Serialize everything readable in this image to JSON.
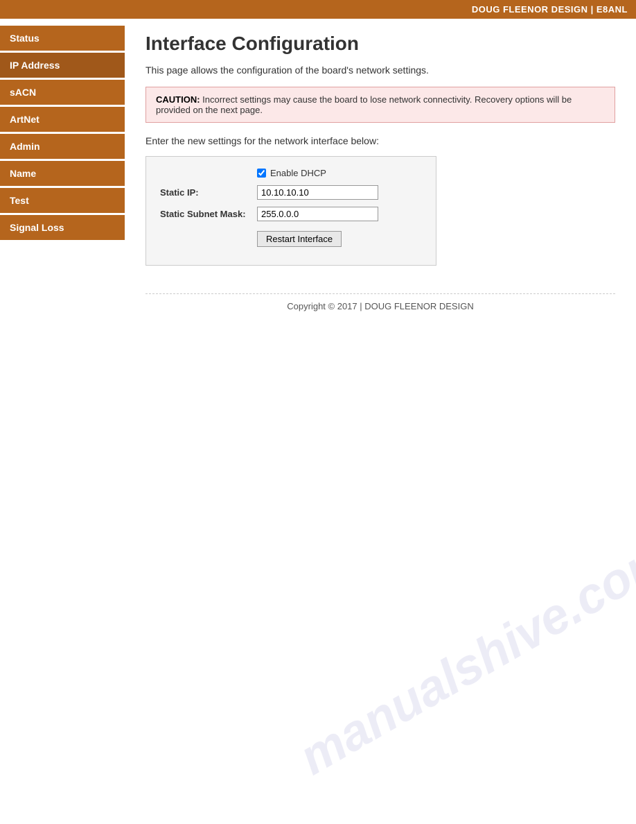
{
  "header": {
    "brand": "DOUG FLEENOR DESIGN | E8ANL"
  },
  "sidebar": {
    "items": [
      {
        "id": "status",
        "label": "Status"
      },
      {
        "id": "ip-address",
        "label": "IP Address"
      },
      {
        "id": "sacn",
        "label": "sACN"
      },
      {
        "id": "artnet",
        "label": "ArtNet"
      },
      {
        "id": "admin",
        "label": "Admin"
      },
      {
        "id": "name",
        "label": "Name"
      },
      {
        "id": "test",
        "label": "Test"
      },
      {
        "id": "signal-loss",
        "label": "Signal Loss"
      }
    ]
  },
  "main": {
    "page_title": "Interface Configuration",
    "description": "This page allows the configuration of the board's network settings.",
    "caution_bold": "CAUTION:",
    "caution_text": " Incorrect settings may cause the board to lose network connectivity. Recovery options will be provided on the next page.",
    "settings_instruction": "Enter the new settings for the network interface below:",
    "form": {
      "dhcp_checkbox_label": "Enable DHCP",
      "dhcp_checked": true,
      "static_ip_label": "Static IP:",
      "static_ip_value": "10.10.10.10",
      "static_subnet_label": "Static Subnet Mask:",
      "static_subnet_value": "255.0.0.0",
      "restart_button_label": "Restart Interface"
    }
  },
  "footer": {
    "text": "Copyright © 2017 | DOUG FLEENOR DESIGN"
  },
  "watermark": {
    "text": "manualshive.com"
  }
}
